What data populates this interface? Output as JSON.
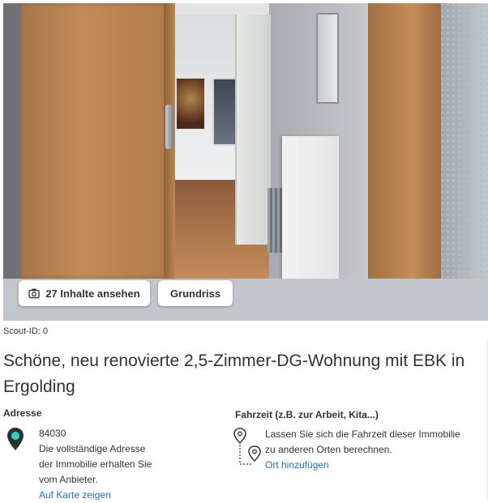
{
  "gallery": {
    "photo_label": "Apartment hallway photo",
    "gallery_button": "27 Inhalte ansehen",
    "floorplan_button": "Grundriss",
    "icons": {
      "gallery": "camera-icon"
    }
  },
  "listing": {
    "scout_id": "Scout-ID: 0",
    "title": "Schöne, neu renovierte 2,5-Zimmer-DG-Wohnung mit EBK in Ergolding"
  },
  "address": {
    "heading": "Adresse",
    "postcode": "84030",
    "note": [
      "Die vollständige Adresse",
      "der Immobilie erhalten Sie",
      "vom Anbieter."
    ],
    "map_link": "Auf Karte zeigen",
    "pin_color": "#2dd4bf"
  },
  "travel": {
    "heading": "Fahrzeit (z.B. zur Arbeit, Kita...)",
    "text_line1": "Lassen Sie sich die Fahrzeit dieser Immobilie",
    "text_line2": "zu anderen Orten berechnen.",
    "add_link": "Ort hinzufügen"
  },
  "colors": {
    "link": "#1f6fbf",
    "text": "#333333",
    "accent": "#2dd4bf"
  }
}
